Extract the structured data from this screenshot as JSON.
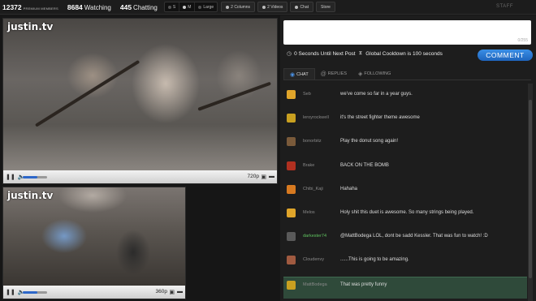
{
  "topbar": {
    "premium_members_count": "12372",
    "premium_members_label": "PREMIUM MEMBERS",
    "watching_count": "8684",
    "watching_label": "Watching",
    "chatting_count": "445",
    "chatting_label": "Chatting",
    "size_options": [
      "S",
      "M",
      "Large"
    ],
    "two_columns_label": "2 Columns",
    "two_videos_label": "2 Videos",
    "chat_label": "Chat",
    "store_label": "Store",
    "staff_label": "STAFF"
  },
  "video_main": {
    "logo": "justin.tv",
    "quality": "720p",
    "volume_level": 0.6
  },
  "video_secondary": {
    "logo": "justin.tv",
    "quality": "360p",
    "volume_level": 0.6
  },
  "chat": {
    "composer_placeholder": "",
    "char_counter": "0/255",
    "next_post_label": "0 Seconds Until Next Post",
    "global_cooldown_label": "Global Cooldown is 100 seconds",
    "comment_button": "COMMENT",
    "tabs": [
      {
        "label": "CHAT",
        "icon": "chat-icon"
      },
      {
        "label": "REPLIES",
        "icon": "at-icon"
      },
      {
        "label": "FOLLOWING",
        "icon": "following-icon"
      }
    ],
    "messages": [
      {
        "user": "Seb",
        "text": "we've come so far in a year guys.",
        "avatar_color": "#e0a52a",
        "name_color": "grey"
      },
      {
        "user": "leroyrockwell",
        "text": "it's the street fighter theme awesome",
        "avatar_color": "#c9a020",
        "name_color": "grey"
      },
      {
        "user": "bonorbitz",
        "text": "Play the donut song again!",
        "avatar_color": "#7a5a3a",
        "name_color": "grey"
      },
      {
        "user": "Brake",
        "text": "BACK ON THE BOMB",
        "avatar_color": "#b03020",
        "name_color": "grey"
      },
      {
        "user": "Chibi_Kaji",
        "text": "Hahaha",
        "avatar_color": "#d87a20",
        "name_color": "grey"
      },
      {
        "user": "Melos",
        "text": "Holy shit this duet is awesome. So many strings being played.",
        "avatar_color": "#e0a52a",
        "name_color": "grey"
      },
      {
        "user": "darkester74",
        "text": "@MattBodega LOL, dont be sadd Kessler. That was fun to watch! :D",
        "avatar_color": "#5a5a5a",
        "name_color": "green"
      },
      {
        "user": "Cloudenvy",
        "text": "......This is going to be amazing.",
        "avatar_color": "#a05a40",
        "name_color": "grey"
      },
      {
        "user": "MattBodega",
        "text": "That was pretty funny",
        "avatar_color": "#c9a020",
        "name_color": "grey",
        "highlighted": true
      }
    ]
  }
}
